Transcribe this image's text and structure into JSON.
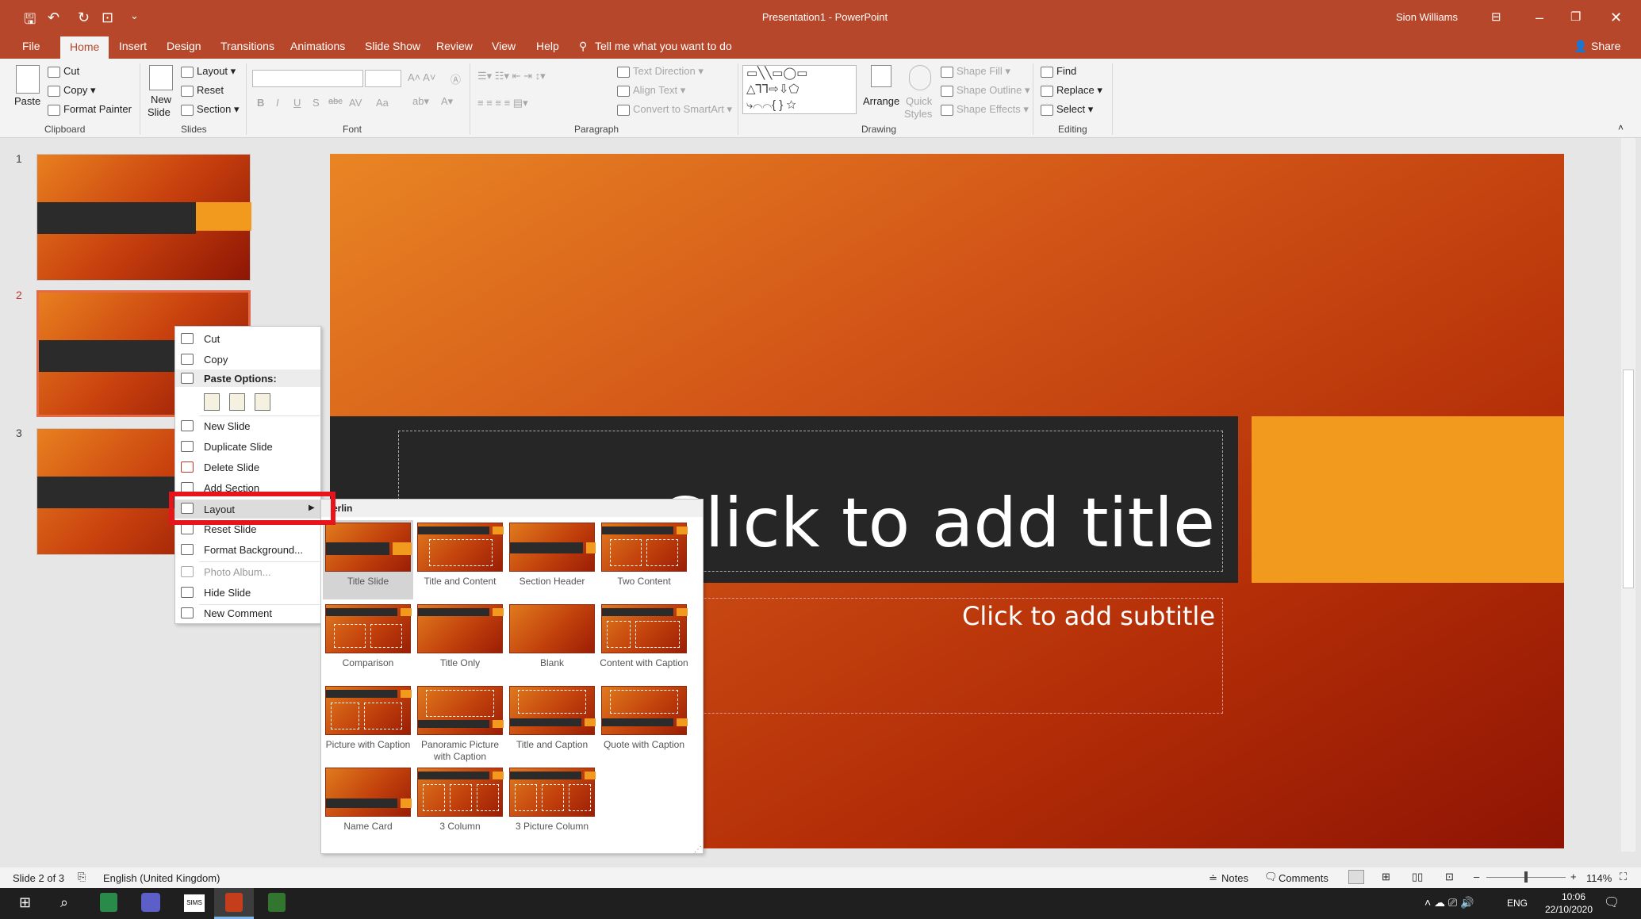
{
  "window": {
    "title": "Presentation1 - PowerPoint",
    "user": "Sion Williams"
  },
  "tabs": [
    "File",
    "Home",
    "Insert",
    "Design",
    "Transitions",
    "Animations",
    "Slide Show",
    "Review",
    "View",
    "Help"
  ],
  "tell_me": "Tell me what you want to do",
  "share": "Share",
  "ribbon": {
    "clipboard": {
      "paste": "Paste",
      "cut": "Cut",
      "copy": "Copy",
      "format_painter": "Format Painter",
      "label": "Clipboard"
    },
    "slides": {
      "new_slide": "New",
      "new_slide2": "Slide",
      "layout": "Layout",
      "reset": "Reset",
      "section": "Section",
      "label": "Slides"
    },
    "font": {
      "label": "Font",
      "bold": "B",
      "italic": "I",
      "underline": "U",
      "shadow": "S",
      "strike": "abc",
      "spacing": "AV",
      "case": "Aa"
    },
    "paragraph": {
      "label": "Paragraph",
      "text_direction": "Text Direction",
      "align_text": "Align Text",
      "smartart": "Convert to SmartArt"
    },
    "drawing": {
      "label": "Drawing",
      "arrange": "Arrange",
      "quick": "Quick",
      "styles": "Styles",
      "fill": "Shape Fill",
      "outline": "Shape Outline",
      "effects": "Shape Effects"
    },
    "editing": {
      "label": "Editing",
      "find": "Find",
      "replace": "Replace",
      "select": "Select"
    }
  },
  "thumbnails": [
    "1",
    "2",
    "3"
  ],
  "slide": {
    "title": "Click to add title",
    "subtitle": "Click to add subtitle"
  },
  "context_menu": {
    "cut": "Cut",
    "copy": "Copy",
    "paste_options": "Paste Options:",
    "new_slide": "New Slide",
    "duplicate": "Duplicate Slide",
    "delete": "Delete Slide",
    "add_section": "Add Section",
    "layout": "Layout",
    "reset": "Reset Slide",
    "format_bg": "Format Background...",
    "photo_album": "Photo Album...",
    "hide": "Hide Slide",
    "new_comment": "New Comment"
  },
  "gallery": {
    "theme": "erlin",
    "layouts": [
      "Title Slide",
      "Title and Content",
      "Section Header",
      "Two Content",
      "Comparison",
      "Title Only",
      "Blank",
      "Content with Caption",
      "Picture with Caption",
      "Panoramic Picture with Caption",
      "Title and Caption",
      "Quote with Caption",
      "Name Card",
      "3 Column",
      "3 Picture Column"
    ]
  },
  "status": {
    "slide": "Slide 2 of 3",
    "language": "English (United Kingdom)",
    "notes": "Notes",
    "comments": "Comments",
    "zoom": "114%"
  },
  "taskbar": {
    "lang": "ENG",
    "time": "10:06",
    "date": "22/10/2020",
    "sims": "SIMS"
  }
}
